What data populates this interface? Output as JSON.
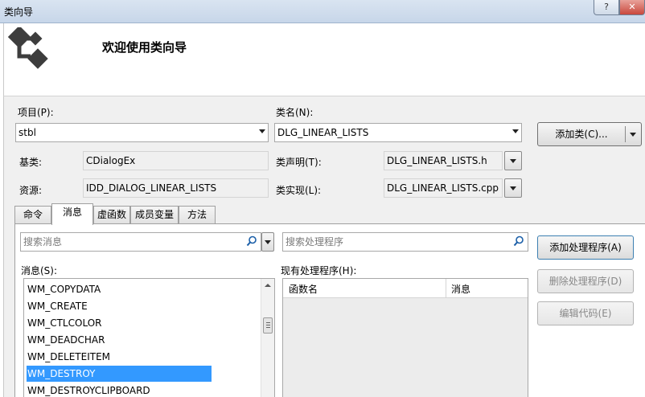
{
  "window": {
    "title": "类向导",
    "help_label": "?",
    "close_label": "✕"
  },
  "banner": {
    "welcome": "欢迎使用类向导"
  },
  "project": {
    "label": "项目(P):",
    "value": "stbl"
  },
  "class_name": {
    "label": "类名(N):",
    "value": "DLG_LINEAR_LISTS"
  },
  "add_class_button": "添加类(C)...",
  "base_class": {
    "label": "基类:",
    "value": "CDialogEx"
  },
  "resource": {
    "label": "资源:",
    "value": "IDD_DIALOG_LINEAR_LISTS"
  },
  "class_declaration": {
    "label": "类声明(T):",
    "value": "DLG_LINEAR_LISTS.h"
  },
  "class_implementation": {
    "label": "类实现(L):",
    "value": "DLG_LINEAR_LISTS.cpp"
  },
  "tabs": [
    {
      "label": "命令"
    },
    {
      "label": "消息",
      "active": true
    },
    {
      "label": "虚函数"
    },
    {
      "label": "成员变量"
    },
    {
      "label": "方法"
    }
  ],
  "search_messages_placeholder": "搜索消息",
  "search_handlers_placeholder": "搜索处理程序",
  "messages": {
    "label": "消息(S):",
    "items": [
      "WM_COPYDATA",
      "WM_CREATE",
      "WM_CTLCOLOR",
      "WM_DEADCHAR",
      "WM_DELETEITEM",
      "WM_DESTROY",
      "WM_DESTROYCLIPBOARD"
    ],
    "selected": "WM_DESTROY"
  },
  "handlers": {
    "label": "现有处理程序(H):",
    "columns": [
      "函数名",
      "消息"
    ]
  },
  "buttons": {
    "add_handler": "添加处理程序(A)",
    "delete_handler": "删除处理程序(D)",
    "edit_code": "编辑代码(E)"
  },
  "colors": {
    "selection": "#3399ff",
    "panel": "#f0f0f0"
  }
}
